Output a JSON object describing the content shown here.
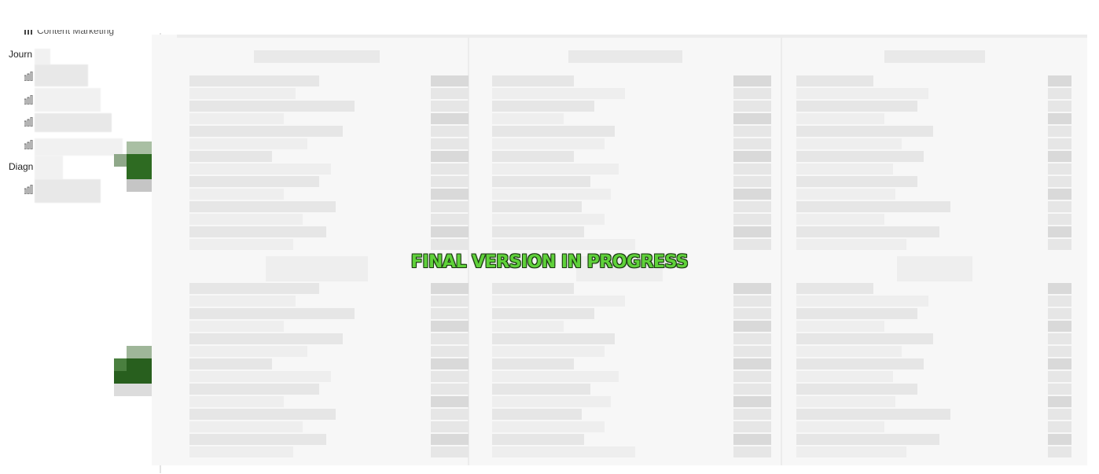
{
  "sidebar": {
    "top_item": "Content Marketing",
    "groups": [
      {
        "label": "Journ",
        "item_count": 4
      },
      {
        "label": "Diagn",
        "item_count": 1
      }
    ],
    "bar_icon": "bar-chart-icon"
  },
  "watermark": {
    "text": "FINAL VERSION IN PROGRESS",
    "color": "#5fd13a"
  },
  "colors": {
    "accent_green": "#2e6b22",
    "panel_bg": "#f7f7f7"
  }
}
